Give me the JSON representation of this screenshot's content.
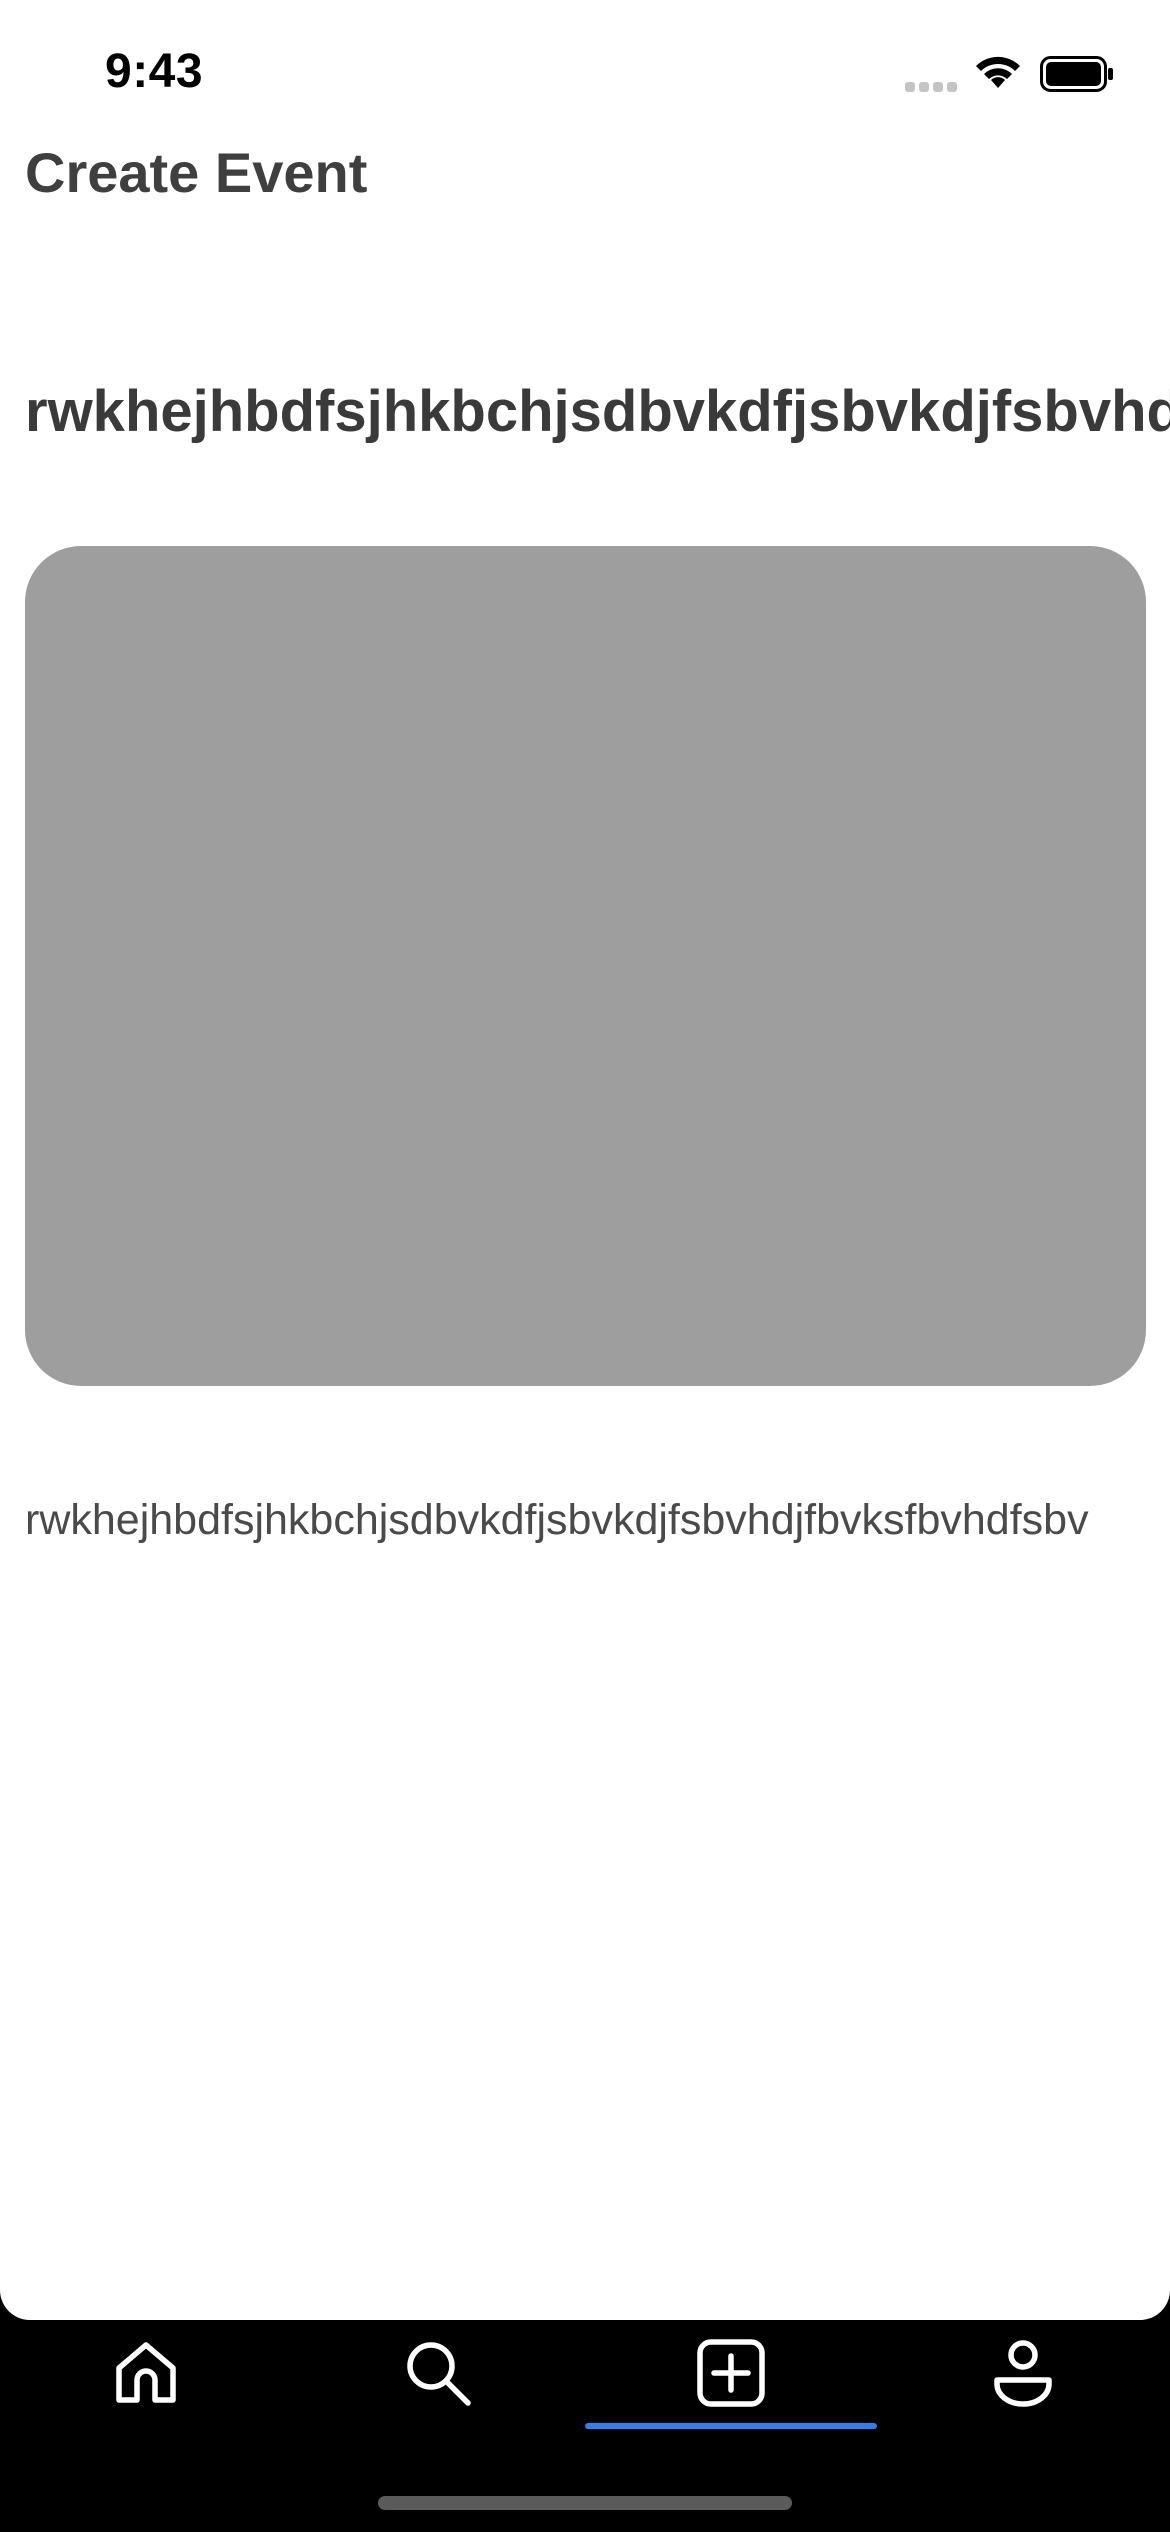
{
  "status_bar": {
    "time": "9:43"
  },
  "header": {
    "title": "Create Event"
  },
  "event": {
    "title": "rwkhejhbdfsjhkbchjsdbvkdfjsbvkdjfsbvhdjfbvksfbvhdfsbv",
    "description": "rwkhejhbdfsjhkbchjsdbvkdfjsbvkdjfsbvhdjfbvksfbvhdfsbv",
    "image_placeholder_color": "#9e9e9e"
  },
  "tab_bar": {
    "items": [
      {
        "name": "home",
        "icon": "home-icon"
      },
      {
        "name": "search",
        "icon": "search-icon"
      },
      {
        "name": "create",
        "icon": "plus-square-icon",
        "active": true
      },
      {
        "name": "profile",
        "icon": "profile-icon"
      }
    ],
    "active_color": "#2f80ed",
    "background": "#000000"
  }
}
